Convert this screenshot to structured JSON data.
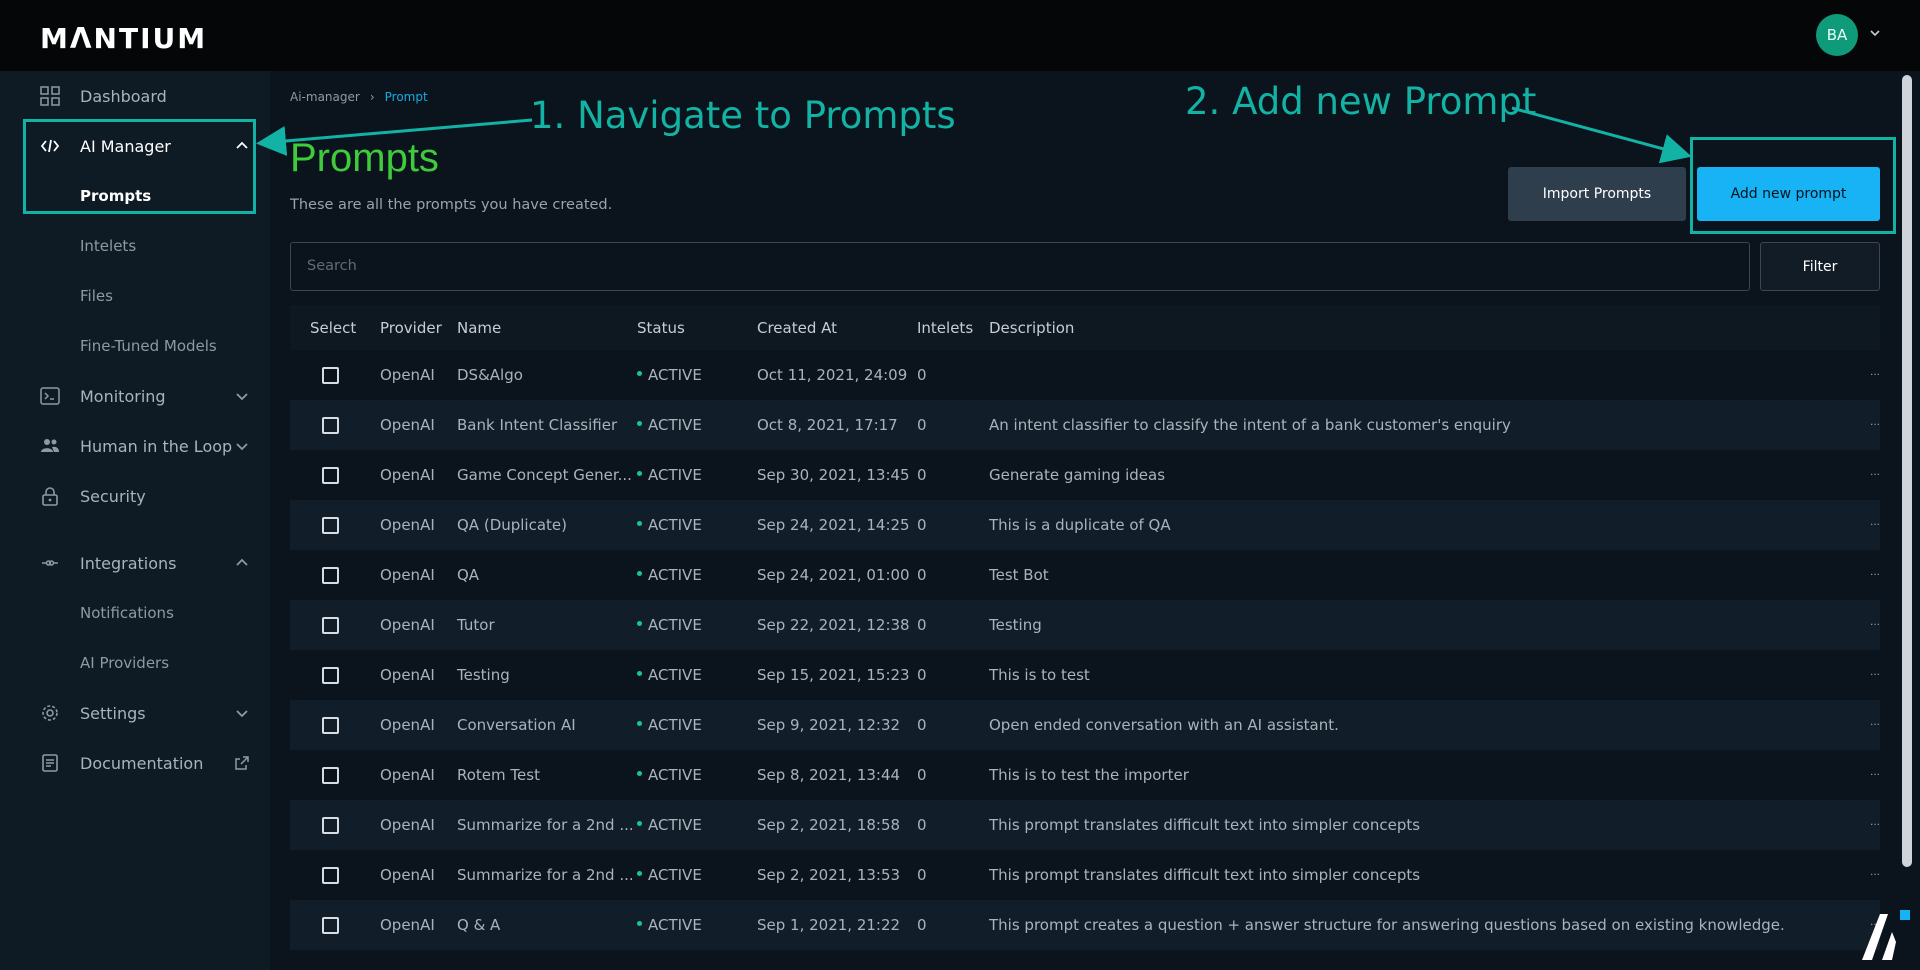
{
  "header": {
    "logo": "MΛNTIUM",
    "avatar_initials": "BA"
  },
  "sidebar": {
    "items": [
      {
        "label": "Dashboard",
        "icon": "dashboard-icon"
      },
      {
        "label": "AI Manager",
        "icon": "code-icon"
      },
      {
        "label": "Prompts"
      },
      {
        "label": "Intelets"
      },
      {
        "label": "Files"
      },
      {
        "label": "Fine-Tuned Models"
      },
      {
        "label": "Monitoring",
        "icon": "terminal-icon"
      },
      {
        "label": "Human in the Loop",
        "icon": "people-icon"
      },
      {
        "label": "Security",
        "icon": "lock-icon"
      },
      {
        "label": "Integrations",
        "icon": "integrations-icon"
      },
      {
        "label": "Notifications"
      },
      {
        "label": "AI Providers"
      },
      {
        "label": "Settings",
        "icon": "gear-icon"
      },
      {
        "label": "Documentation",
        "icon": "document-icon"
      }
    ]
  },
  "breadcrumb": {
    "parent": "Ai-manager",
    "separator": "›",
    "current": "Prompt"
  },
  "page": {
    "title": "Prompts",
    "subtitle": "These are all the prompts you have created.",
    "import_label": "Import Prompts",
    "add_label": "Add new prompt"
  },
  "search": {
    "placeholder": "Search"
  },
  "filter_label": "Filter",
  "table": {
    "headers": [
      "Select",
      "Provider",
      "Name",
      "Status",
      "Created At",
      "Intelets",
      "Description"
    ],
    "rows": [
      {
        "provider": "OpenAI",
        "name": "DS&Algo",
        "status": "ACTIVE",
        "created": "Oct 11, 2021, 24:09",
        "intelets": "0",
        "description": ""
      },
      {
        "provider": "OpenAI",
        "name": "Bank Intent Classifier",
        "status": "ACTIVE",
        "created": "Oct 8, 2021, 17:17",
        "intelets": "0",
        "description": "An intent classifier to classify the intent of a bank customer's enquiry"
      },
      {
        "provider": "OpenAI",
        "name": "Game Concept Gener...",
        "status": "ACTIVE",
        "created": "Sep 30, 2021, 13:45",
        "intelets": "0",
        "description": "Generate gaming ideas"
      },
      {
        "provider": "OpenAI",
        "name": "QA (Duplicate)",
        "status": "ACTIVE",
        "created": "Sep 24, 2021, 14:25",
        "intelets": "0",
        "description": "This is a duplicate of QA"
      },
      {
        "provider": "OpenAI",
        "name": "QA",
        "status": "ACTIVE",
        "created": "Sep 24, 2021, 01:00",
        "intelets": "0",
        "description": "Test Bot"
      },
      {
        "provider": "OpenAI",
        "name": "Tutor",
        "status": "ACTIVE",
        "created": "Sep 22, 2021, 12:38",
        "intelets": "0",
        "description": "Testing"
      },
      {
        "provider": "OpenAI",
        "name": "Testing",
        "status": "ACTIVE",
        "created": "Sep 15, 2021, 15:23",
        "intelets": "0",
        "description": "This is to test"
      },
      {
        "provider": "OpenAI",
        "name": "Conversation AI",
        "status": "ACTIVE",
        "created": "Sep 9, 2021, 12:32",
        "intelets": "0",
        "description": "Open ended conversation with an AI assistant."
      },
      {
        "provider": "OpenAI",
        "name": "Rotem Test",
        "status": "ACTIVE",
        "created": "Sep 8, 2021, 13:44",
        "intelets": "0",
        "description": "This is to test the importer"
      },
      {
        "provider": "OpenAI",
        "name": "Summarize for a 2nd ...",
        "status": "ACTIVE",
        "created": "Sep 2, 2021, 18:58",
        "intelets": "0",
        "description": "This prompt translates difficult text into simpler concepts"
      },
      {
        "provider": "OpenAI",
        "name": "Summarize for a 2nd ...",
        "status": "ACTIVE",
        "created": "Sep 2, 2021, 13:53",
        "intelets": "0",
        "description": "This prompt translates difficult text into simpler concepts"
      },
      {
        "provider": "OpenAI",
        "name": "Q & A",
        "status": "ACTIVE",
        "created": "Sep 1, 2021, 21:22",
        "intelets": "0",
        "description": "This prompt creates a question + answer structure for answering questions based on existing knowledge."
      }
    ],
    "more_glyph": "..."
  },
  "annotations": {
    "step1": "1. Navigate to Prompts",
    "step2": "2. Add new Prompt"
  },
  "colors": {
    "accent": "#17b3f5",
    "title_green": "#3fcb3b",
    "annotation": "#12b3a4",
    "status_dot": "#18c4a0",
    "avatar": "#0f9b7a"
  }
}
